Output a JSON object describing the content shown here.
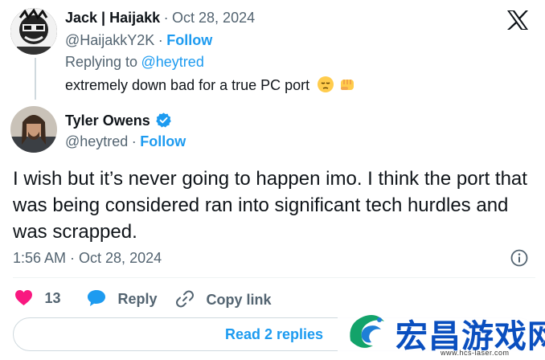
{
  "reply_tweet": {
    "display_name": "Jack | Haijakk",
    "separator": "·",
    "date": "Oct 28, 2024",
    "handle": "@HaijakkY2K",
    "follow_label": "Follow",
    "replying_prefix": "Replying to",
    "replying_to": "@heytred",
    "text": "extremely down bad for a true PC port",
    "emojis": [
      "pensive-face",
      "oncoming-fist"
    ]
  },
  "main_tweet": {
    "display_name": "Tyler Owens",
    "verified": true,
    "handle": "@heytred",
    "follow_label": "Follow",
    "text": "I wish but it’s never going to happen imo. I think the port that was being considered ran into significant tech hurdles and was scrapped.",
    "timestamp": "1:56 AM · Oct 28, 2024"
  },
  "actions": {
    "likes_count": "13",
    "reply_label": "Reply",
    "copy_link_label": "Copy link"
  },
  "read_replies_label": "Read 2 replies",
  "watermark": {
    "text": "宏昌游戏网",
    "url": "www.hcs-laser.com"
  },
  "colors": {
    "accent": "#1d9bf0",
    "like": "#f91880",
    "muted": "#536471",
    "text": "#0f1419"
  }
}
